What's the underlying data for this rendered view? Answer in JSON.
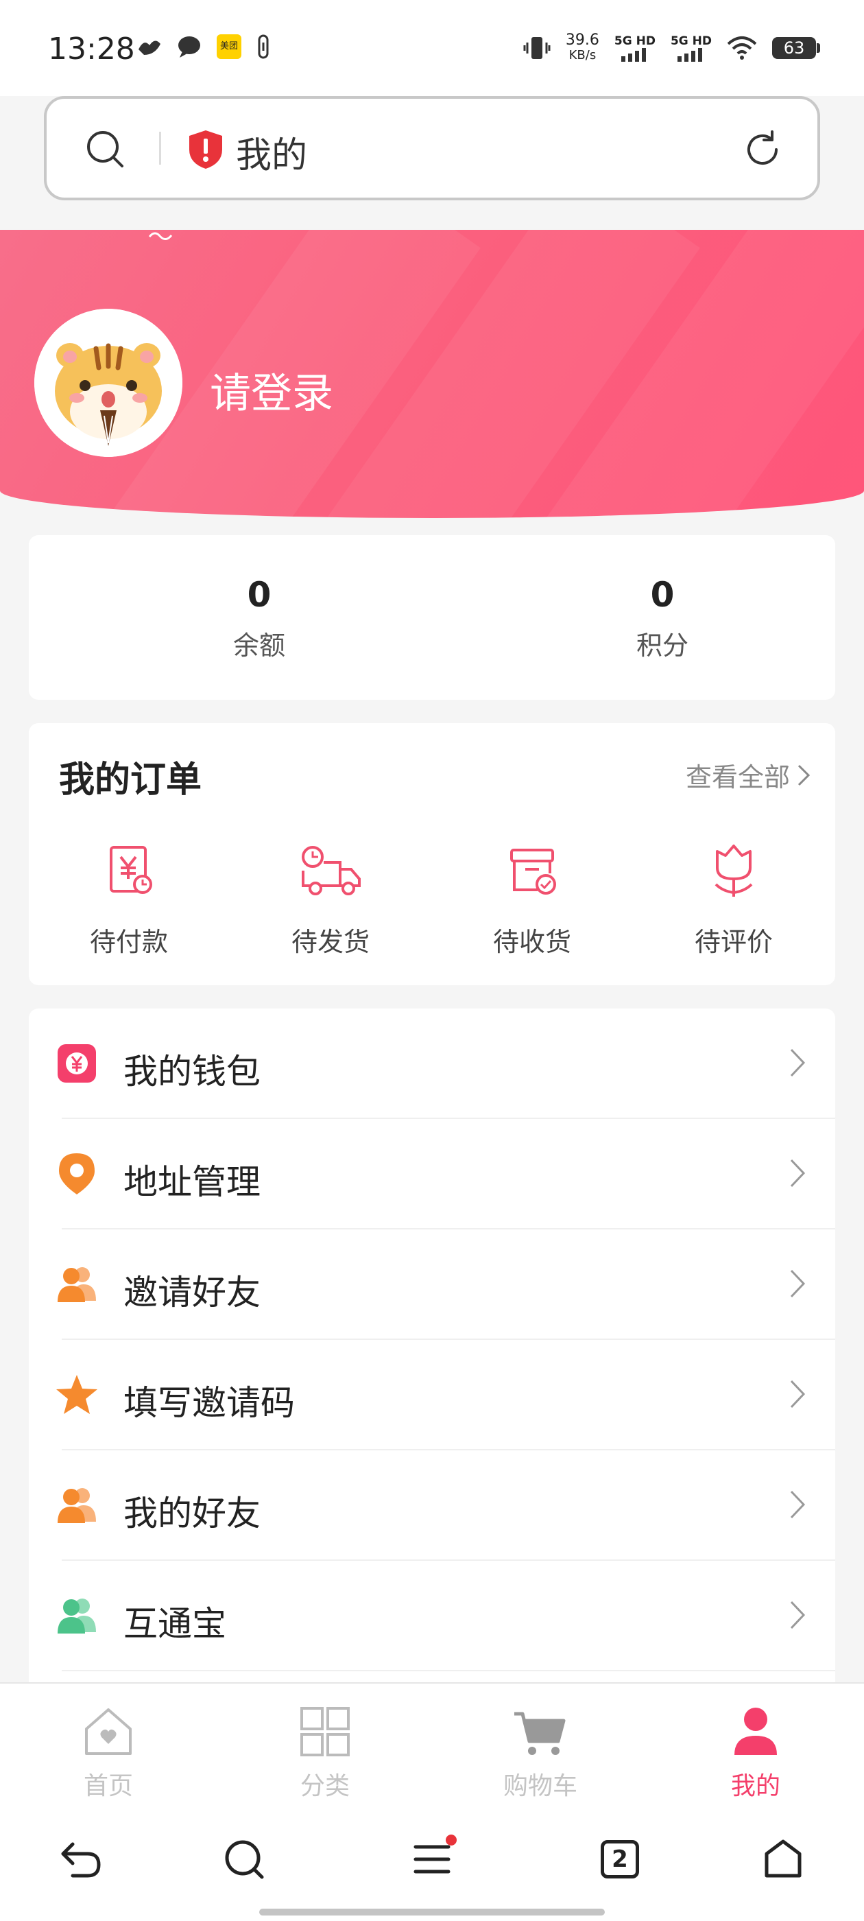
{
  "status_bar": {
    "time": "13:28",
    "net_speed_value": "39.6",
    "net_speed_unit": "KB/s",
    "sim1": "5G HD",
    "sim2": "5G HD",
    "battery": "63",
    "app_badge": "美团"
  },
  "address_bar": {
    "title": "我的",
    "icons": [
      "search-icon",
      "shield-alert-icon",
      "refresh-icon"
    ]
  },
  "profile": {
    "login_text": "请登录"
  },
  "stats": [
    {
      "value": "0",
      "label": "余额"
    },
    {
      "value": "0",
      "label": "积分"
    }
  ],
  "orders": {
    "title": "我的订单",
    "view_all": "查看全部",
    "items": [
      {
        "label": "待付款",
        "icon": "invoice-yen-icon"
      },
      {
        "label": "待发货",
        "icon": "delivery-truck-icon"
      },
      {
        "label": "待收货",
        "icon": "box-check-icon"
      },
      {
        "label": "待评价",
        "icon": "flower-icon"
      }
    ]
  },
  "menu": [
    {
      "label": "我的钱包",
      "icon": "wallet-yen-icon"
    },
    {
      "label": "地址管理",
      "icon": "location-pin-icon"
    },
    {
      "label": "邀请好友",
      "icon": "users-icon"
    },
    {
      "label": "填写邀请码",
      "icon": "star-icon"
    },
    {
      "label": "我的好友",
      "icon": "users-icon"
    },
    {
      "label": "互通宝",
      "icon": "users-icon"
    }
  ],
  "tabbar": [
    {
      "label": "首页",
      "icon": "home-heart-icon",
      "active": false
    },
    {
      "label": "分类",
      "icon": "grid-icon",
      "active": false
    },
    {
      "label": "购物车",
      "icon": "cart-icon",
      "active": false
    },
    {
      "label": "我的",
      "icon": "person-icon",
      "active": true
    }
  ],
  "browser_nav": {
    "tab_count": "2"
  },
  "colors": {
    "brand": "#f43f6b",
    "banner": "#fb5f7d",
    "orange": "#f58a2e",
    "green": "#4cc38a"
  }
}
